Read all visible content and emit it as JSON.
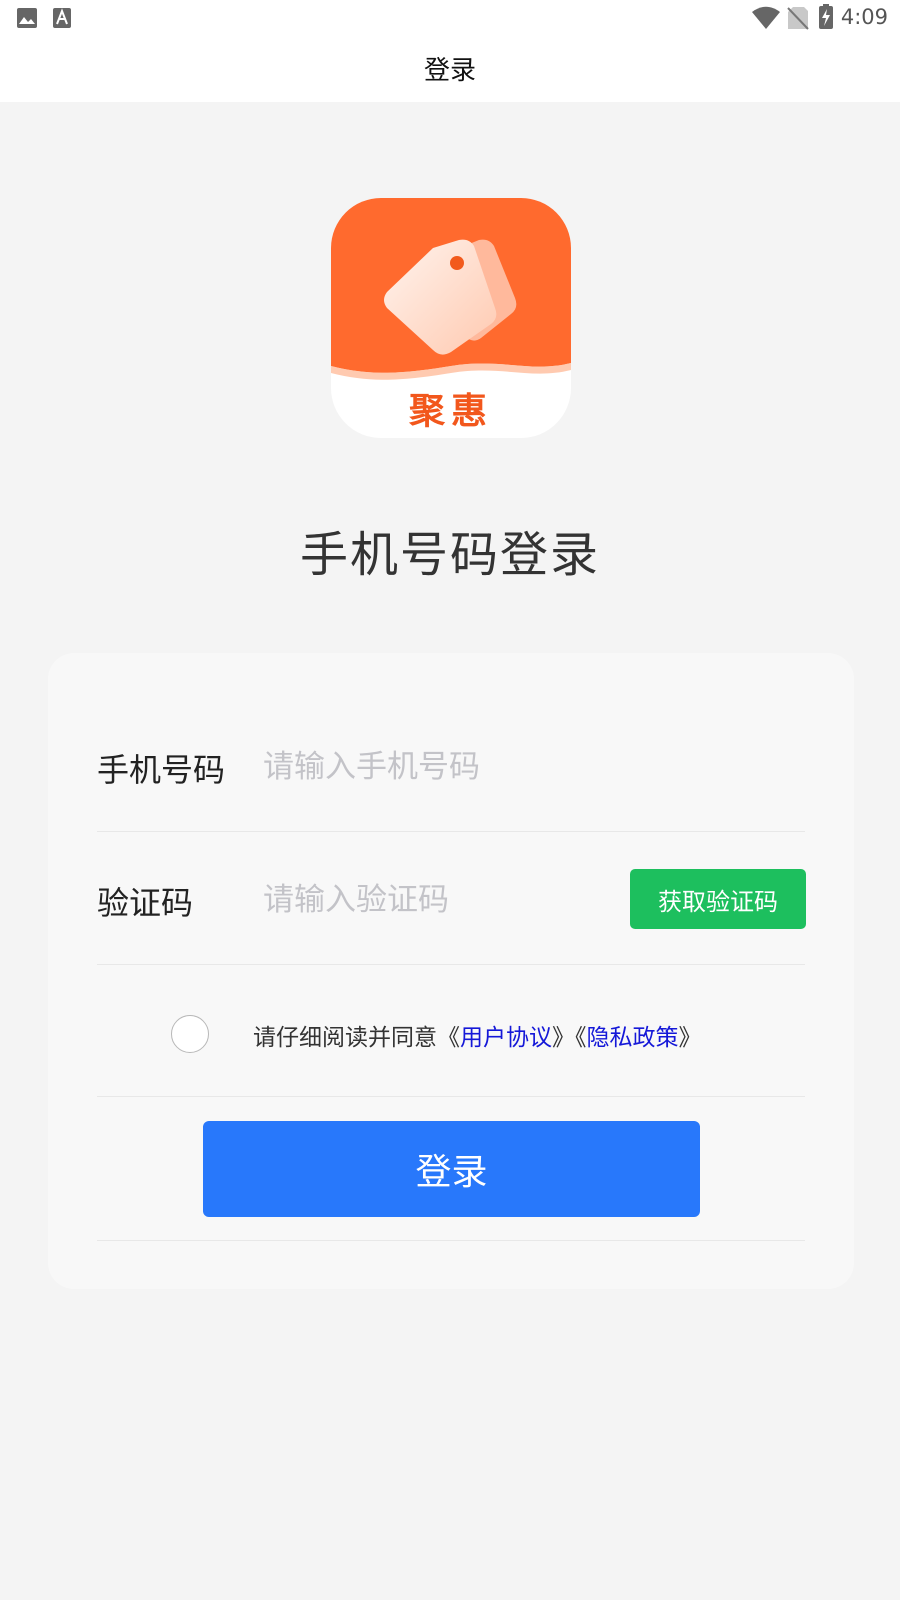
{
  "status_bar": {
    "time": "4:09",
    "left_icons": [
      "image-icon",
      "font-icon"
    ],
    "right_icons": [
      "wifi-icon",
      "no-sim-icon",
      "battery-charging-icon"
    ]
  },
  "header": {
    "title": "登录"
  },
  "logo": {
    "brand_text": "聚惠",
    "accent_color": "#ff6a2e"
  },
  "heading": "手机号码登录",
  "form": {
    "phone": {
      "label": "手机号码",
      "placeholder": "请输入手机号码",
      "value": ""
    },
    "code": {
      "label": "验证码",
      "placeholder": "请输入验证码",
      "value": "",
      "button_label": "获取验证码",
      "button_color": "#1dbf5e"
    },
    "agreement": {
      "checked": false,
      "prefix": "请仔细阅读并同意《",
      "user_agreement": "用户协议",
      "middle": "》《",
      "privacy_policy": "隐私政策",
      "suffix": "》",
      "link_color": "#1518d8"
    },
    "login_button": {
      "label": "登录",
      "color": "#2878fb"
    }
  }
}
